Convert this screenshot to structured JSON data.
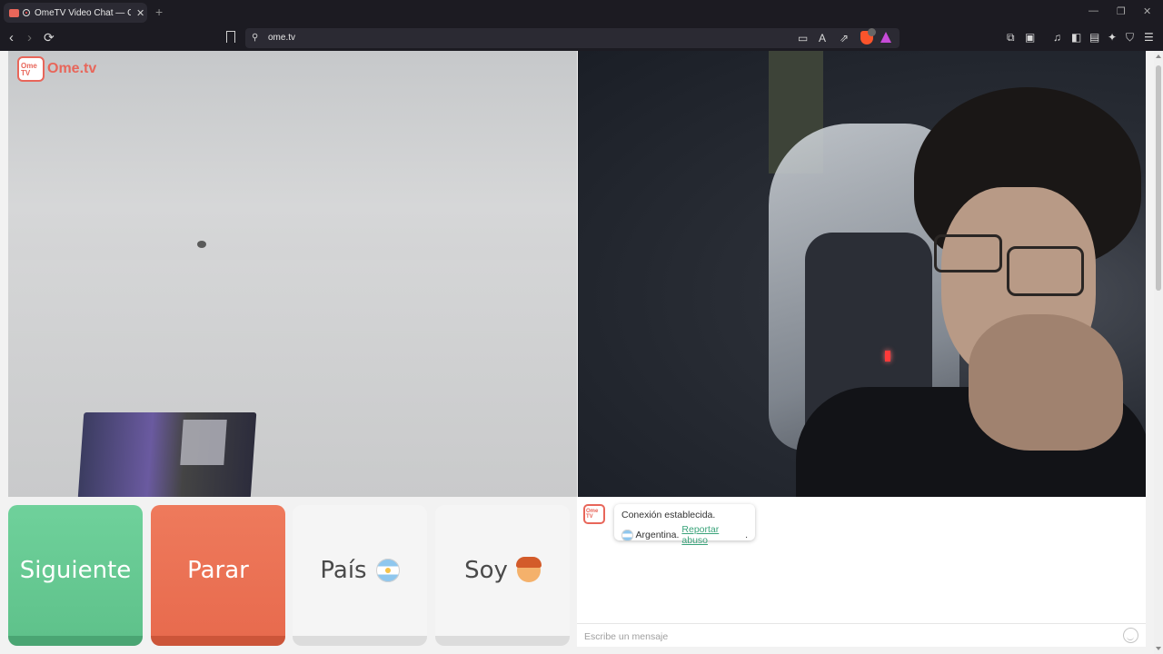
{
  "browser": {
    "tab_title": "OmeTV Video Chat — Omeg",
    "tab_close": "✕",
    "new_tab": "+",
    "window_controls": {
      "minimize": "—",
      "restore": "❐",
      "close": "✕"
    },
    "url": "ome.tv",
    "nav": {
      "back": "‹",
      "forward": "›",
      "reload": "⟳"
    }
  },
  "site": {
    "logo_text": "Ome.tv",
    "logo_tv_text": "Ome TV",
    "brand_color": "#e8665a"
  },
  "controls": {
    "next_label": "Siguiente",
    "stop_label": "Parar",
    "country_label": "País",
    "gender_label": "Soy",
    "country_flag_icon": "argentina-flag-icon",
    "gender_icon": "boy-avatar-icon"
  },
  "chat": {
    "connected_message": "Conexión establecida.",
    "country_name": "Argentina.",
    "report_link": "Reportar abuso",
    "report_suffix": ".",
    "input_placeholder": "Escribe un mensaje",
    "emoji_icon": "smiley-icon"
  },
  "colors": {
    "next_button": "#5fc28b",
    "stop_button": "#e86b4e",
    "link": "#3aa37a"
  }
}
